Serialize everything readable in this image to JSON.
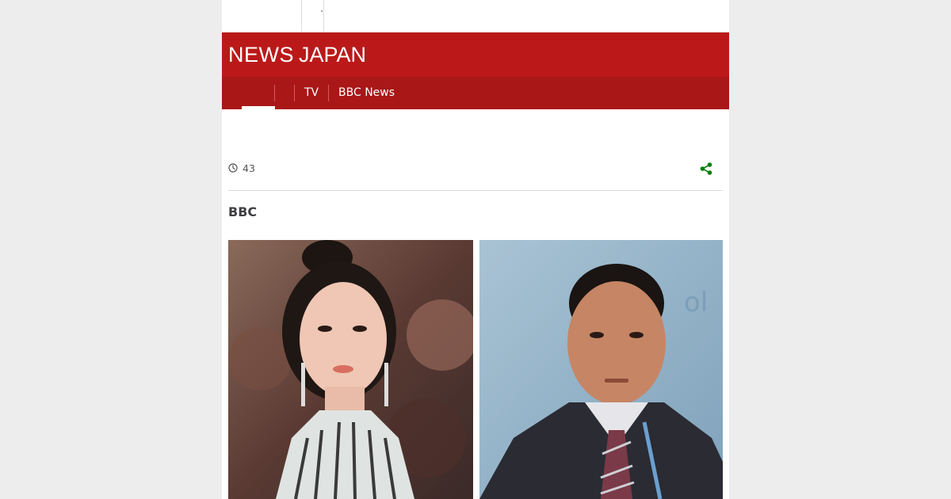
{
  "masthead": {
    "logo_news": "NEWS",
    "logo_region": "JAPAN",
    "brand_color": "#bb1919"
  },
  "nav": {
    "items": [
      {
        "label": ""
      },
      {
        "label": ""
      },
      {
        "label": "TV"
      },
      {
        "label": "BBC News"
      }
    ]
  },
  "article": {
    "timestamp": "43",
    "byline": "BBC",
    "share_icon": "share-icon",
    "clock_icon": "clock-icon",
    "accent_color": "#008000"
  }
}
